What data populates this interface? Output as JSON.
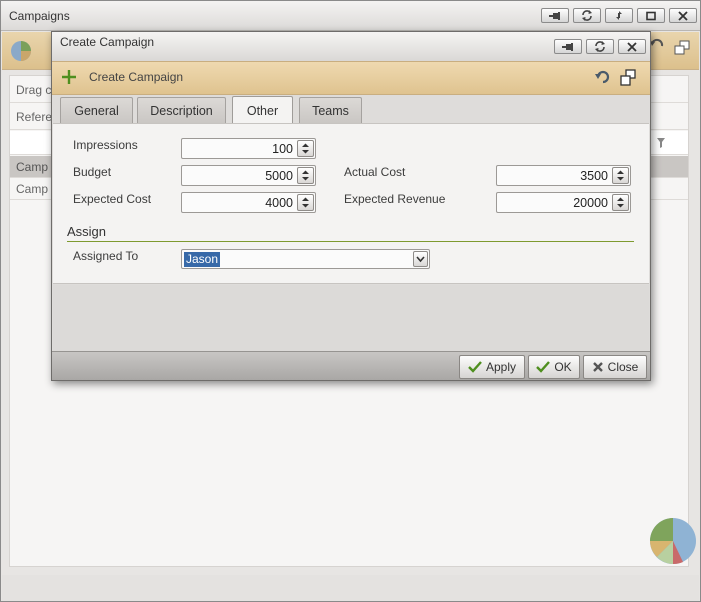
{
  "background_window": {
    "title": "Campaigns",
    "partial_texts": {
      "drag_hint": "Drag c",
      "refer_header": "Refere",
      "row_1": "Camp",
      "row_2": "Camp"
    },
    "title_buttons": [
      "pin-icon",
      "refresh-icon",
      "restore-icon",
      "maximize-icon",
      "close-icon"
    ]
  },
  "dialog": {
    "title": "Create Campaign",
    "header_title": "Create Campaign",
    "title_buttons": [
      "pin-icon",
      "refresh-icon",
      "close-icon"
    ],
    "tabs": [
      {
        "label": "General",
        "active": false
      },
      {
        "label": "Description",
        "active": false
      },
      {
        "label": "Other",
        "active": true
      },
      {
        "label": "Teams",
        "active": false
      }
    ],
    "fields": {
      "impressions": {
        "label": "Impressions",
        "value": "100"
      },
      "budget": {
        "label": "Budget",
        "value": "5000"
      },
      "expected_cost": {
        "label": "Expected Cost",
        "value": "4000"
      },
      "actual_cost": {
        "label": "Actual Cost",
        "value": "3500"
      },
      "expected_revenue": {
        "label": "Expected Revenue",
        "value": "20000"
      }
    },
    "assign_section": {
      "title": "Assign",
      "assigned_to_label": "Assigned To",
      "assigned_to_value": "Jason"
    },
    "footer": {
      "apply": "Apply",
      "ok": "OK",
      "close": "Close"
    }
  },
  "colors": {
    "header_band": "#e4c994",
    "section_line": "#7e9a2f",
    "selection": "#3769a8",
    "check_green": "#4f8f1f"
  }
}
